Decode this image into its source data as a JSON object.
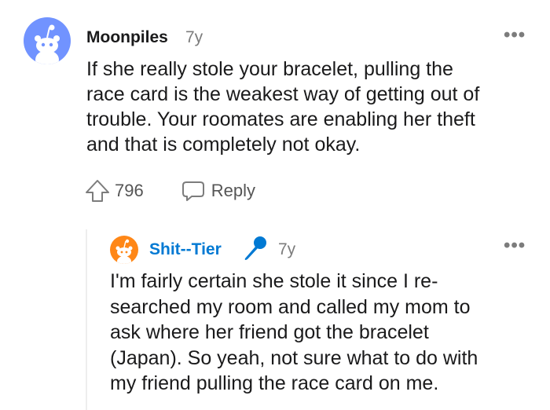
{
  "comments": [
    {
      "username": "Moonpiles",
      "age": "7y",
      "more": "•••",
      "body": "If she really stole your bracelet, pulling the\nrace card is the weakest way of getting out of\ntrouble. Your roomates are enabling her theft\nand that is completely not okay.",
      "upvotes": "796",
      "reply_label": "Reply",
      "avatar_color": "#7193ff"
    },
    {
      "username": "Shit--Tier",
      "age": "7y",
      "more": "•••",
      "username_color": "#0079d3",
      "body": "I'm fairly certain she stole it since I re-\nsearched my room and called my mom to\nask where her friend got the bracelet\n(Japan). So yeah, not sure what to do with\nmy friend pulling the race card on me.",
      "avatar_color": "#ff8717"
    }
  ],
  "icons": {
    "upvote": "upvote-arrow-icon",
    "reply": "speech-bubble-icon",
    "flair": "microphone-icon"
  }
}
